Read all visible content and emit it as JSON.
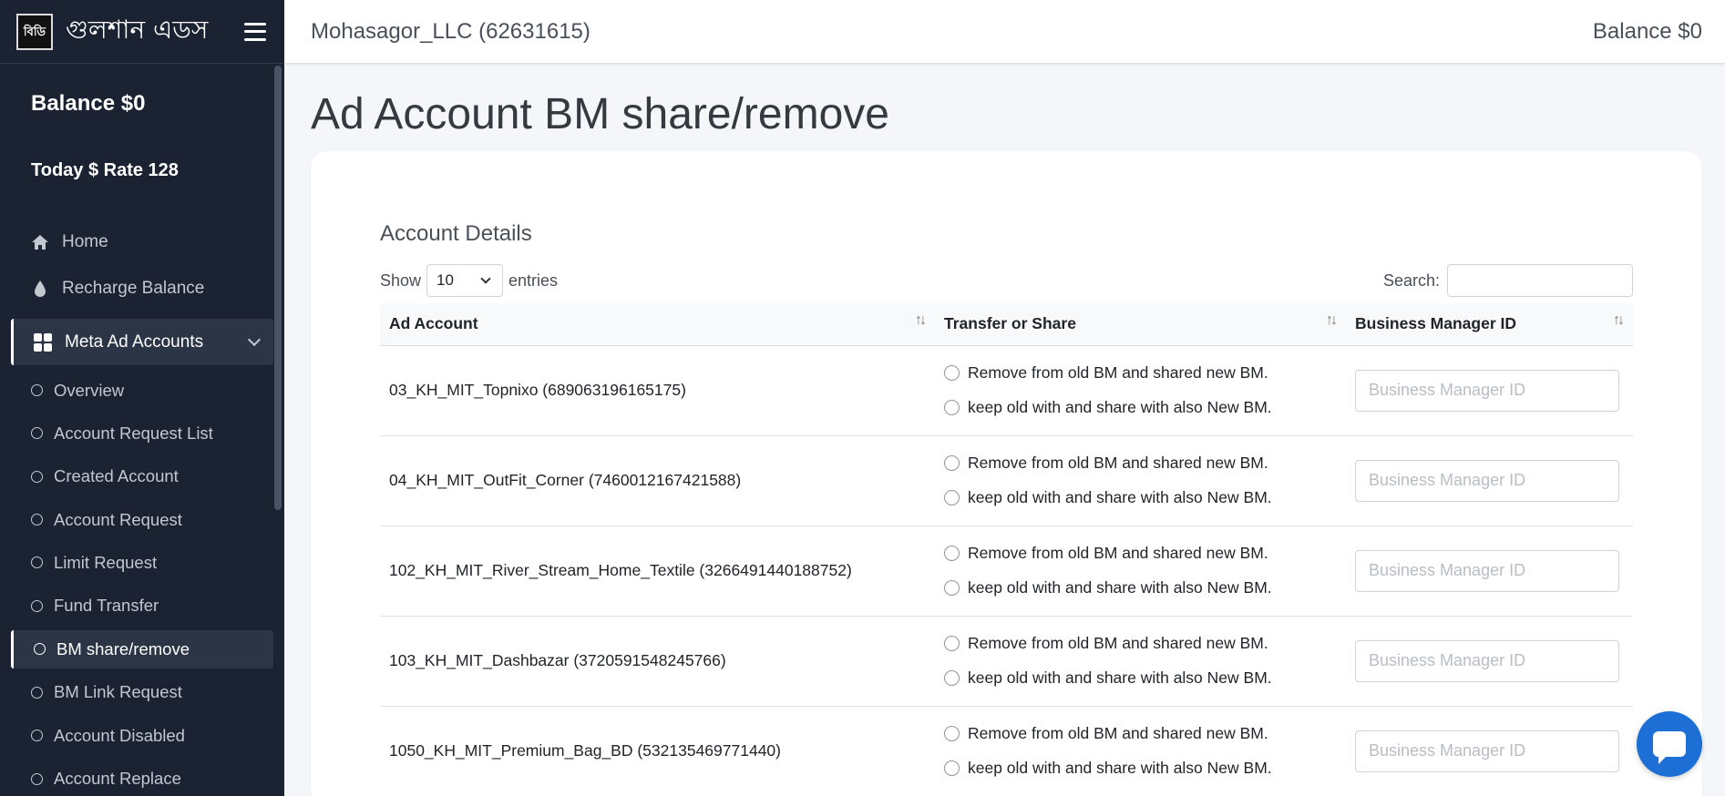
{
  "brand": {
    "logo_text": "বিডি",
    "name": "গুলশান এডস"
  },
  "sidebar": {
    "balance": "Balance $0",
    "rate": "Today $ Rate 128",
    "nav": [
      {
        "label": "Home",
        "icon": "home-icon"
      },
      {
        "label": "Recharge Balance",
        "icon": "drop-icon"
      }
    ],
    "parent": {
      "label": "Meta Ad Accounts",
      "icon": "grid-icon"
    },
    "sub_items": [
      {
        "label": "Overview"
      },
      {
        "label": "Account Request List"
      },
      {
        "label": "Created Account"
      },
      {
        "label": "Account Request"
      },
      {
        "label": "Limit Request"
      },
      {
        "label": "Fund Transfer"
      },
      {
        "label": "BM share/remove",
        "active": true
      },
      {
        "label": "BM Link Request"
      },
      {
        "label": "Account Disabled"
      },
      {
        "label": "Account Replace"
      }
    ]
  },
  "topbar": {
    "account": "Mohasagor_LLC (62631615)",
    "balance": "Balance $0"
  },
  "page": {
    "title": "Ad Account BM share/remove"
  },
  "card": {
    "title": "Account Details",
    "show_label": "Show",
    "entries_value": "10",
    "entries_label": "entries",
    "search_label": "Search:",
    "search_value": ""
  },
  "table": {
    "columns": [
      "Ad Account",
      "Transfer or Share",
      "Business Manager ID"
    ],
    "option_remove": "Remove from old BM and shared new BM.",
    "option_keep": "keep old with and share with also New BM.",
    "input_placeholder": "Business Manager ID",
    "rows": [
      {
        "account": "03_KH_MIT_Topnixo (689063196165175)"
      },
      {
        "account": "04_KH_MIT_OutFit_Corner (7460012167421588)"
      },
      {
        "account": "102_KH_MIT_River_Stream_Home_Textile (3266491440188752)"
      },
      {
        "account": "103_KH_MIT_Dashbazar (3720591548245766)"
      },
      {
        "account": "1050_KH_MIT_Premium_Bag_BD (532135469771440)"
      }
    ]
  },
  "colors": {
    "sidebar_bg": "#1b2332",
    "accent": "#1d6fd6"
  }
}
